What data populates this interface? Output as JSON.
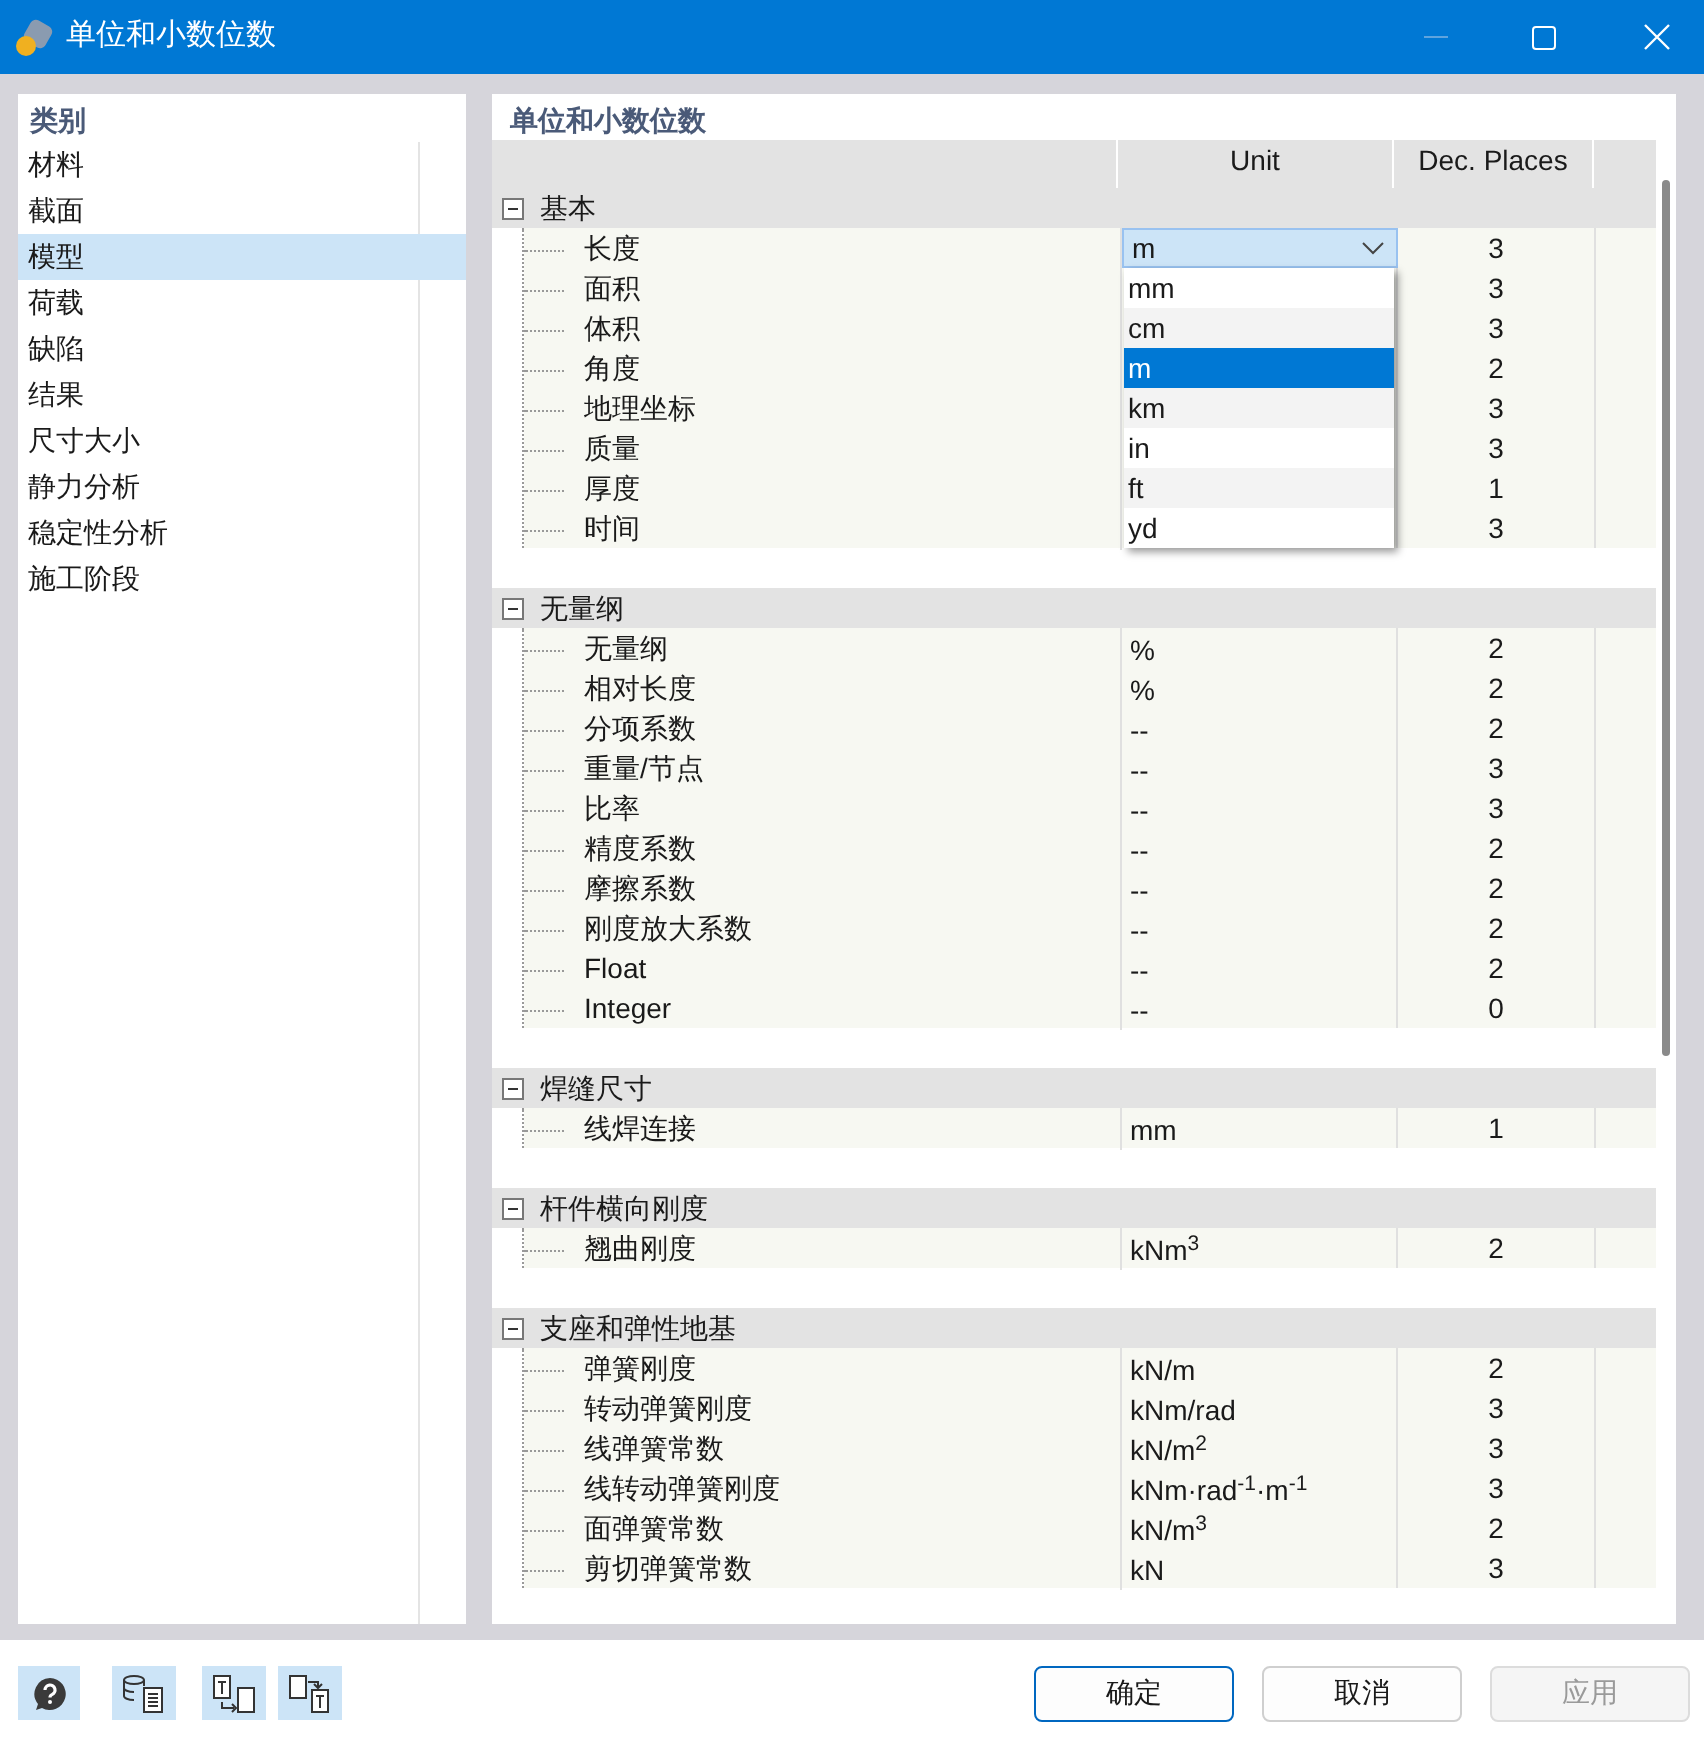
{
  "window": {
    "title": "单位和小数位数"
  },
  "categories": {
    "header": "类别",
    "items": [
      {
        "label": "材料",
        "selected": false
      },
      {
        "label": "截面",
        "selected": false
      },
      {
        "label": "模型",
        "selected": true
      },
      {
        "label": "荷载",
        "selected": false
      },
      {
        "label": "缺陷",
        "selected": false
      },
      {
        "label": "结果",
        "selected": false
      },
      {
        "label": "尺寸大小",
        "selected": false
      },
      {
        "label": "静力分析",
        "selected": false
      },
      {
        "label": "稳定性分析",
        "selected": false
      },
      {
        "label": "施工阶段",
        "selected": false
      }
    ]
  },
  "panel": {
    "title": "单位和小数位数",
    "columns": [
      "Unit",
      "Dec. Places"
    ],
    "groups": [
      {
        "label": "基本",
        "expanded": true,
        "rows": [
          {
            "label": "长度",
            "unit": "m",
            "decimals": "3",
            "editing": true
          },
          {
            "label": "面积",
            "decimals": "3"
          },
          {
            "label": "体积",
            "decimals": "3"
          },
          {
            "label": "角度",
            "decimals": "2"
          },
          {
            "label": "地理坐标",
            "decimals": "3"
          },
          {
            "label": "质量",
            "decimals": "3"
          },
          {
            "label": "厚度",
            "decimals": "1"
          },
          {
            "label": "时间",
            "decimals": "3"
          }
        ]
      },
      {
        "label": "无量纲",
        "expanded": true,
        "rows": [
          {
            "label": "无量纲",
            "unit": "%",
            "decimals": "2"
          },
          {
            "label": "相对长度",
            "unit": "%",
            "decimals": "2"
          },
          {
            "label": "分项系数",
            "unit": "--",
            "decimals": "2"
          },
          {
            "label": "重量/节点",
            "unit": "--",
            "decimals": "3"
          },
          {
            "label": "比率",
            "unit": "--",
            "decimals": "3"
          },
          {
            "label": "精度系数",
            "unit": "--",
            "decimals": "2"
          },
          {
            "label": "摩擦系数",
            "unit": "--",
            "decimals": "2"
          },
          {
            "label": "刚度放大系数",
            "unit": "--",
            "decimals": "2"
          },
          {
            "label": "Float",
            "unit": "--",
            "decimals": "2"
          },
          {
            "label": "Integer",
            "unit": "--",
            "decimals": "0"
          }
        ]
      },
      {
        "label": "焊缝尺寸",
        "expanded": true,
        "rows": [
          {
            "label": "线焊连接",
            "unit": "mm",
            "decimals": "1"
          }
        ]
      },
      {
        "label": "杆件横向刚度",
        "expanded": true,
        "rows": [
          {
            "label": "翘曲刚度",
            "unit": "kNm$^{3}$",
            "decimals": "2"
          }
        ]
      },
      {
        "label": "支座和弹性地基",
        "expanded": true,
        "rows": [
          {
            "label": "弹簧刚度",
            "unit": "kN/m",
            "decimals": "2"
          },
          {
            "label": "转动弹簧刚度",
            "unit": "kNm/rad",
            "decimals": "3"
          },
          {
            "label": "线弹簧常数",
            "unit": "kN/m$^{2}$",
            "decimals": "3"
          },
          {
            "label": "线转动弹簧刚度",
            "unit": "kNm·rad$^{-1}$·m$^{-1}$",
            "decimals": "3"
          },
          {
            "label": "面弹簧常数",
            "unit": "kN/m$^{3}$",
            "decimals": "2"
          },
          {
            "label": "剪切弹簧常数",
            "unit": "kN",
            "decimals": "3"
          }
        ]
      }
    ]
  },
  "dropdown": {
    "items": [
      {
        "label": "mm",
        "selected": false
      },
      {
        "label": "cm",
        "selected": false
      },
      {
        "label": "m",
        "selected": true
      },
      {
        "label": "km",
        "selected": false
      },
      {
        "label": "in",
        "selected": false
      },
      {
        "label": "ft",
        "selected": false
      },
      {
        "label": "yd",
        "selected": false
      }
    ]
  },
  "buttons": [
    {
      "label": "确定",
      "default": true,
      "disabled": false
    },
    {
      "label": "取消",
      "default": false,
      "disabled": false
    },
    {
      "label": "应用",
      "default": false,
      "disabled": true
    }
  ]
}
